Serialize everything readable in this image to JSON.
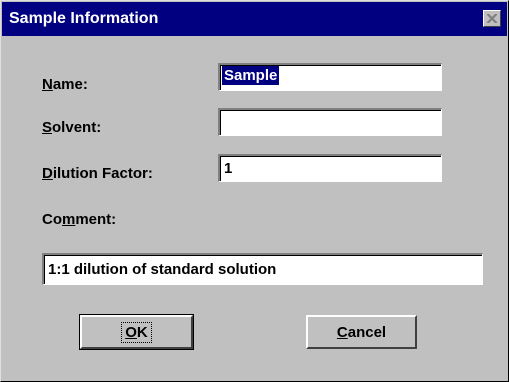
{
  "dialog": {
    "title": "Sample Information"
  },
  "fields": {
    "name": {
      "label_pre": "",
      "label_key": "N",
      "label_post": "ame:",
      "value": "Sample"
    },
    "solvent": {
      "label_pre": "",
      "label_key": "S",
      "label_post": "olvent:",
      "value": ""
    },
    "dilution": {
      "label_pre": "",
      "label_key": "D",
      "label_post": "ilution Factor:",
      "value": "1"
    },
    "comment": {
      "label_pre": "Co",
      "label_key": "m",
      "label_post": "ment:",
      "value": "1:1 dilution of standard solution"
    }
  },
  "buttons": {
    "ok": {
      "label_key": "O",
      "label_post": "K"
    },
    "cancel": {
      "label_key": "C",
      "label_post": "ancel"
    }
  },
  "colors": {
    "titlebar": "#000080",
    "face": "#c0c0c0",
    "selection": "#000080"
  },
  "icons": {
    "close": "close-icon"
  }
}
